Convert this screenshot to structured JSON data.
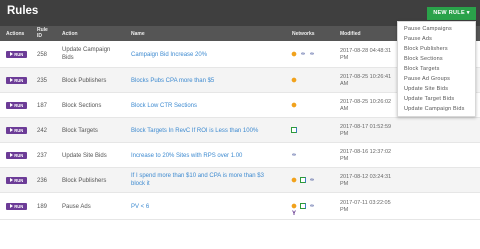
{
  "header": {
    "title": "Rules",
    "new_rule_label": "NEW RULE",
    "new_rule_icon": "caret-down-icon"
  },
  "columns": {
    "actions": "Actions",
    "rule_id_l1": "Rule",
    "rule_id_l2": "ID",
    "action": "Action",
    "name": "Name",
    "networks": "Networks",
    "modified": "Modified"
  },
  "run_label": "RUN",
  "rows": [
    {
      "id": "258",
      "action_l1": "Update Campaign",
      "action_l2": "Bids",
      "name_l1": "Campaign Bid Increase 20%",
      "name_l2": "",
      "networks": [
        "orange-ball-icon",
        "tripadvisor-owl-icon",
        "tripadvisor-owl-icon"
      ],
      "modified_l1": "2017-08-28 04:48:31",
      "modified_l2": "PM"
    },
    {
      "id": "235",
      "action_l1": "Block Publishers",
      "action_l2": "",
      "name_l1": "Blocks Pubs CPA more than $5",
      "name_l2": "",
      "networks": [
        "orange-ball-icon"
      ],
      "modified_l1": "2017-08-25 10:26:41",
      "modified_l2": "AM"
    },
    {
      "id": "187",
      "action_l1": "Block Sections",
      "action_l2": "",
      "name_l1": "Block Low CTR Sections",
      "name_l2": "",
      "networks": [
        "orange-ball-icon"
      ],
      "modified_l1": "2017-08-25 10:26:02",
      "modified_l2": "AM"
    },
    {
      "id": "242",
      "action_l1": "Block Targets",
      "action_l2": "",
      "name_l1": "Block Targets In RevC If ROI is Less than 100%",
      "name_l2": "",
      "networks": [
        "green-square-icon"
      ],
      "modified_l1": "2017-08-17 01:52:59",
      "modified_l2": "PM"
    },
    {
      "id": "237",
      "action_l1": "Update Site Bids",
      "action_l2": "",
      "name_l1": "Increase to 20% Sites with RPS over 1.00",
      "name_l2": "",
      "networks": [
        "tripadvisor-owl-icon"
      ],
      "modified_l1": "2017-08-16 12:37:02",
      "modified_l2": "PM"
    },
    {
      "id": "236",
      "action_l1": "Block Publishers",
      "action_l2": "",
      "name_l1": "If I spend more than $10 and CPA is more than $3",
      "name_l2": "block it",
      "networks": [
        "orange-ball-icon",
        "green-square-icon",
        "tripadvisor-owl-icon"
      ],
      "modified_l1": "2017-08-12 03:24:31",
      "modified_l2": "PM"
    },
    {
      "id": "189",
      "action_l1": "Pause Ads",
      "action_l2": "",
      "name_l1": "PV < 6",
      "name_l2": "",
      "networks": [
        "orange-ball-icon",
        "green-square-icon",
        "tripadvisor-owl-icon",
        "yahoo-icon"
      ],
      "modified_l1": "2017-07-11 03:22:05",
      "modified_l2": "PM"
    }
  ],
  "dropdown": [
    "Pause Campaigns",
    "Pause Ads",
    "Block Publishers",
    "Block Sections",
    "Block Targets",
    "Pause Ad Groups",
    "Update Site Bids",
    "Update Target Bids",
    "Update Campaign Bids"
  ],
  "colors": {
    "header_bg": "#3f3f3f",
    "table_head_bg": "#555555",
    "new_rule_green": "#2aa24a",
    "run_purple": "#6c3c97",
    "link_blue": "#3d8ad0"
  }
}
